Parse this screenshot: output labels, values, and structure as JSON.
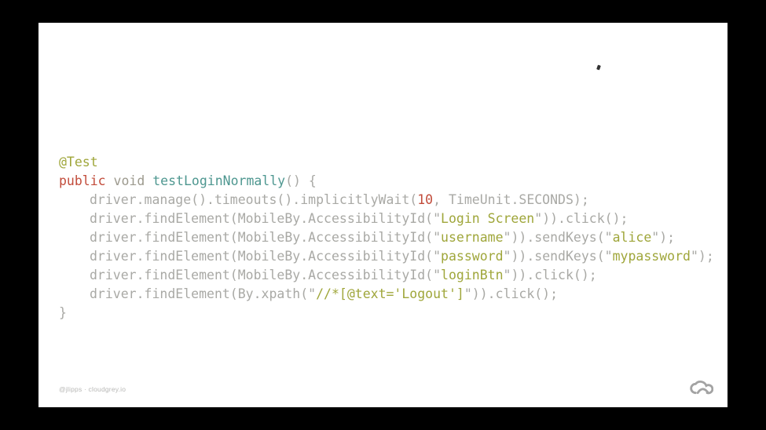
{
  "code": {
    "annotation": "@Test",
    "kw_public": "public",
    "kw_void": "void",
    "func_name": "testLoginNormally",
    "sig_tail": "() {",
    "l1_a": "driver.manage().timeouts().implicitlyWait(",
    "l1_num": "10",
    "l1_b": ", TimeUnit.SECONDS);",
    "l2_a": "driver.findElement(MobileBy.AccessibilityId(",
    "l2_str": "Login Screen",
    "l2_b": ")).click();",
    "l3_a": "driver.findElement(MobileBy.AccessibilityId(",
    "l3_str": "username",
    "l3_b": ")).sendKeys(",
    "l3_str2": "alice",
    "l3_c": ");",
    "l4_a": "driver.findElement(MobileBy.AccessibilityId(",
    "l4_str": "password",
    "l4_b": ")).sendKeys(",
    "l4_str2": "mypassword",
    "l4_c": ");",
    "l5_a": "driver.findElement(MobileBy.AccessibilityId(",
    "l5_str": "loginBtn",
    "l5_b": ")).click();",
    "l6_a": "driver.findElement(By.xpath(",
    "l6_str": "//*[@text='Logout']",
    "l6_b": ")).click();",
    "close_brace": "}",
    "quote": "\""
  },
  "footer": {
    "text": "@jlipps · cloudgrey.io"
  },
  "logo": {
    "name": "cloudgrey-logo"
  }
}
